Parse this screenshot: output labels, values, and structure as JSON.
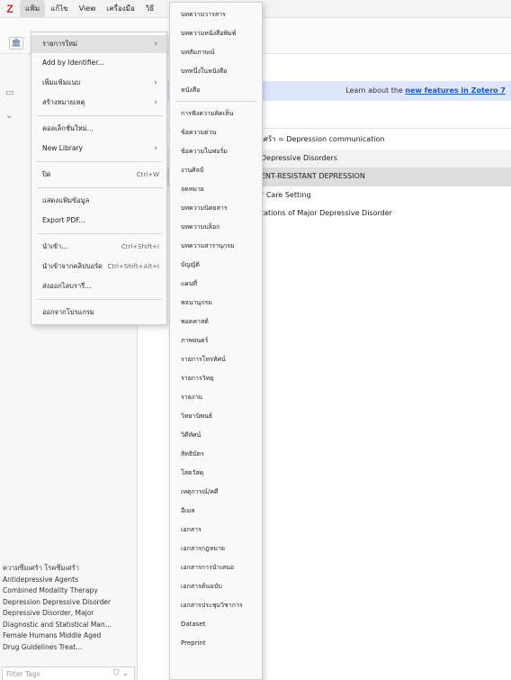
{
  "app": {
    "logo": "Z"
  },
  "menubar": {
    "items": [
      "แฟ้ม",
      "แก้ไข",
      "View",
      "เครื่องมือ",
      "วิธี"
    ]
  },
  "library_button": "🏛",
  "banner": {
    "text": "Learn about the ",
    "link": "new features in Zotero 7"
  },
  "items": [
    "เศร้า = Depression communication",
    "Depressive Disorders",
    "ENT-RESISTANT DEPRESSION",
    "r Care Setting",
    "tations of Major Depressive Disorder"
  ],
  "file_menu": {
    "items": [
      {
        "label": "รายการใหม่",
        "arrow": "›",
        "shortcut": ""
      },
      {
        "label": "Add by Identifier...",
        "arrow": "",
        "shortcut": ""
      },
      {
        "label": "เพิ่มแฟ้มแนบ",
        "arrow": "›",
        "shortcut": ""
      },
      {
        "label": "สร้างหมายเหตุ",
        "arrow": "›",
        "shortcut": ""
      },
      {
        "label": "คอลเล็กชั่นใหม่...",
        "arrow": "",
        "shortcut": ""
      },
      {
        "label": "New Library",
        "arrow": "›",
        "shortcut": ""
      },
      {
        "label": "ปิด",
        "arrow": "",
        "shortcut": "Ctrl+W"
      },
      {
        "label": "แสดงแฟ้มข้อมูล",
        "arrow": "",
        "shortcut": ""
      },
      {
        "label": "Export PDF...",
        "arrow": "",
        "shortcut": ""
      },
      {
        "label": "นำเข้า...",
        "arrow": "",
        "shortcut": "Ctrl+Shift+I"
      },
      {
        "label": "นำเข้าจากคลิปบอร์ด",
        "arrow": "",
        "shortcut": "Ctrl+Shift+Alt+I"
      },
      {
        "label": "ส่งออกไลบรารี่...",
        "arrow": "",
        "shortcut": ""
      },
      {
        "label": "ออกจากโปรแกรม",
        "arrow": "",
        "shortcut": ""
      }
    ]
  },
  "new_item_submenu": {
    "items": [
      "บทความวารสาร",
      "บทความหนังสือพิมพ์",
      "บทสัมภาษณ์",
      "บทหนึ่งในหนังสือ",
      "หนังสือ",
      "การฟังความคิดเห็น",
      "ข้อความด่วน",
      "ข้อความในฟอรั่ม",
      "งานศิลป์",
      "จดหมาย",
      "บทความนิตยสาร",
      "บทความบล็อก",
      "บทความสารานุกรม",
      "บัญญัติ",
      "แผนที่",
      "พจนานุกรม",
      "พอดคาสต์",
      "ภาพยนตร์",
      "รายการโทรทัศน์",
      "รายการวิทยุ",
      "รายงาน",
      "วิทยานิพนธ์",
      "วิดีทัศน์",
      "สิทธิบัตร",
      "โสตวัสดุ",
      "เหตุการณ์/คดี",
      "อีเมล",
      "เอกสาร",
      "เอกสารกฎหมาย",
      "เอกสารการนำเสนอ",
      "เอกสารต้นฉบับ",
      "เอกสารประชุมวิชาการ",
      "Dataset",
      "Preprint"
    ]
  },
  "tags": [
    "ความซึมเศร้า   โรคซึมเศร้า",
    "Antidepressive Agents",
    "Combined Modality Therapy",
    "Depression   Depressive Disorder",
    "Depressive Disorder, Major",
    "Diagnostic and Statistical Man...",
    "Female   Humans   Middle Aged",
    "Drug    Guidelines   Treat..."
  ],
  "filter_tags": {
    "placeholder": "Filter Tags",
    "icon": "⛉ ⌄"
  },
  "colors": {
    "logo": "#cc2936",
    "banner_bg": "#dfe6fb",
    "link": "#1a55c7",
    "menu_highlight": "#e1e1e1"
  }
}
